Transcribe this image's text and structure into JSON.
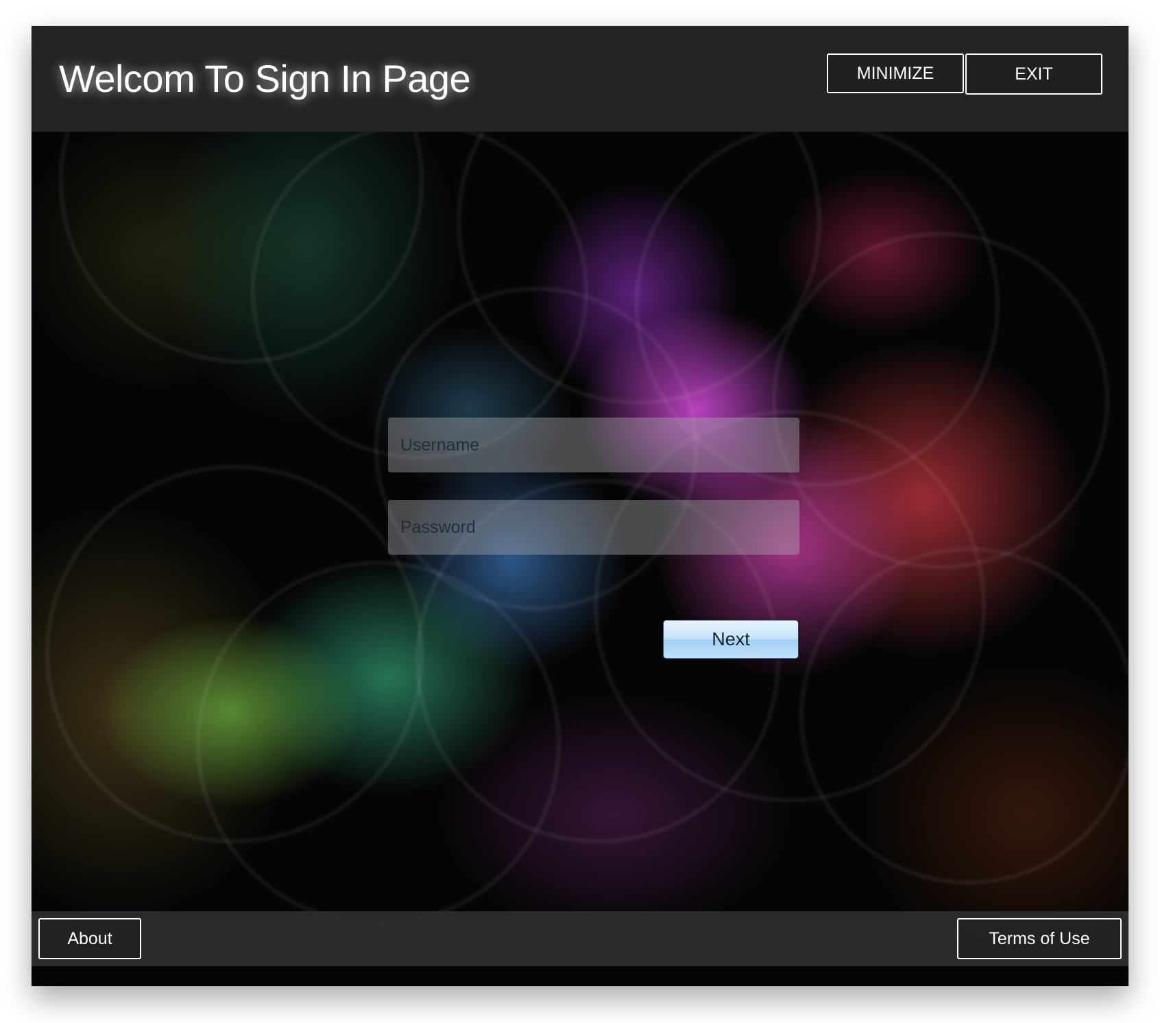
{
  "header": {
    "title": "Welcom To Sign In Page",
    "minimize_label": "MINIMIZE",
    "exit_label": "EXIT"
  },
  "form": {
    "username": {
      "value": "",
      "placeholder": "Username"
    },
    "password": {
      "value": "",
      "placeholder": "Password"
    },
    "next_label": "Next"
  },
  "footer": {
    "about_label": "About",
    "terms_label": "Terms of Use"
  },
  "colors": {
    "header_bg": "#262628",
    "text": "#ffffff",
    "next_button": "#bfe2fb"
  }
}
